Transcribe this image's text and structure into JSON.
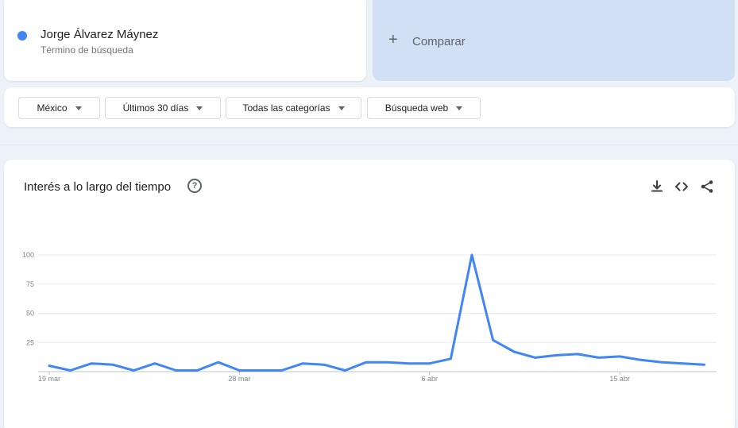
{
  "term": {
    "title": "Jorge Álvarez Máynez",
    "subtitle": "Término de búsqueda",
    "color": "#4285f4"
  },
  "compare": {
    "plus": "+",
    "label": "Comparar"
  },
  "filters": {
    "region": "México",
    "period": "Últimos 30 días",
    "category": "Todas las categorías",
    "search_type": "Búsqueda web"
  },
  "chart": {
    "title": "Interés a lo largo del tiempo",
    "help": "?",
    "icons": [
      "download-icon",
      "embed-code-icon",
      "share-icon"
    ]
  },
  "chart_data": {
    "type": "line",
    "title": "Interés a lo largo del tiempo",
    "xlabel": "",
    "ylabel": "",
    "ylim": [
      0,
      100
    ],
    "yticks": [
      25,
      50,
      75,
      100
    ],
    "xtick_labels": [
      {
        "index": 0,
        "label": "19 mar"
      },
      {
        "index": 9,
        "label": "28 mar"
      },
      {
        "index": 18,
        "label": "6 abr"
      },
      {
        "index": 27,
        "label": "15 abr"
      }
    ],
    "grid": true,
    "color": "#4285f4",
    "series": [
      {
        "values": [
          5,
          1,
          7,
          6,
          1,
          7,
          1,
          1,
          8,
          1,
          1,
          1,
          7,
          6,
          1,
          8,
          8,
          7,
          7,
          11,
          100,
          27,
          17,
          12,
          14,
          15,
          12,
          13,
          10,
          8,
          7,
          6
        ]
      }
    ]
  }
}
